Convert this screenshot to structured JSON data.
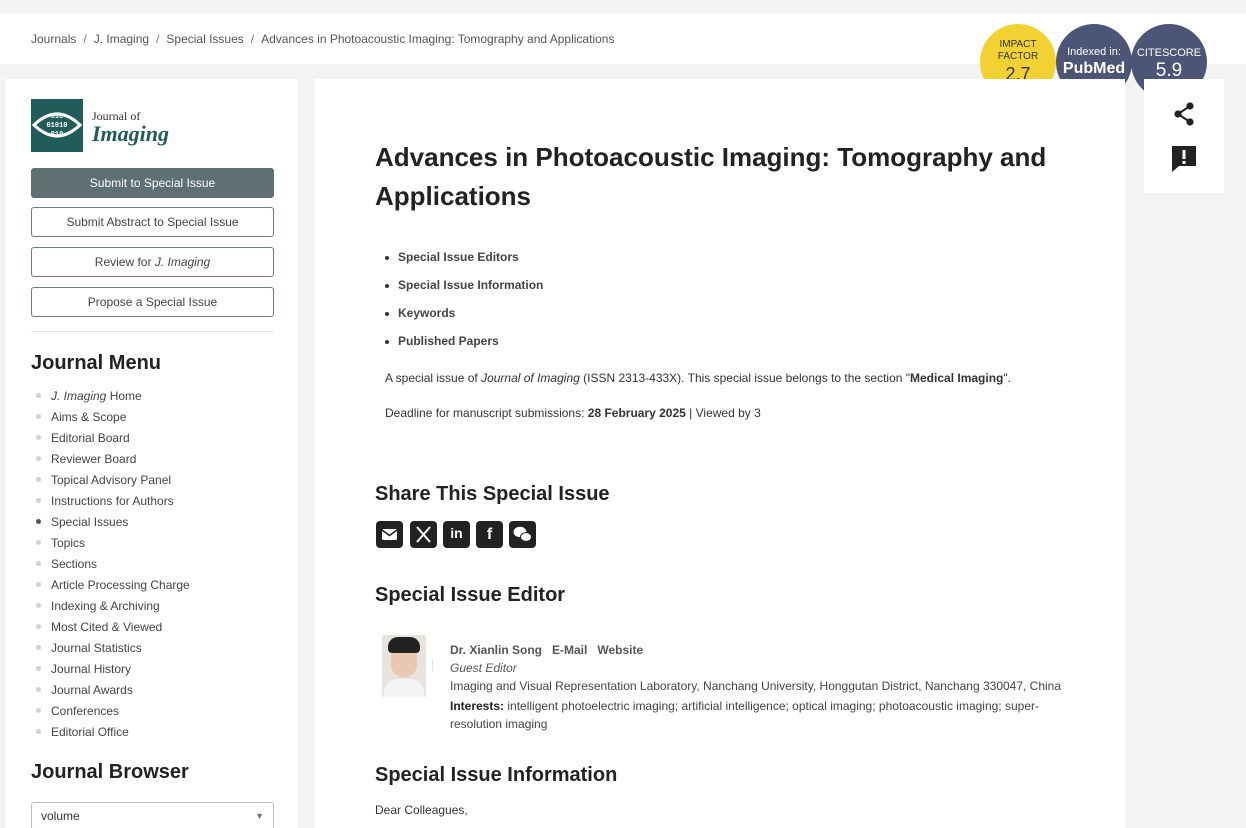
{
  "breadcrumb": {
    "items": [
      "Journals",
      "J. Imaging",
      "Special Issues",
      "Advances in Photoacoustic Imaging: Tomography and Applications"
    ],
    "separator": "/"
  },
  "metrics": {
    "impact_factor_label": "IMPACT FACTOR",
    "impact_factor_value": "2.7",
    "indexed_label": "Indexed in:",
    "indexed_value": "PubMed",
    "citescore_label": "CITESCORE",
    "citescore_value": "5.9"
  },
  "logo": {
    "mark_text": "010\n01010\n010",
    "line1": "Journal of",
    "line2": "Imaging"
  },
  "sidebar": {
    "buttons": {
      "submit": "Submit to Special Issue",
      "submit_abstract": "Submit Abstract to Special Issue",
      "review_prefix": "Review for ",
      "review_journal": "J. Imaging",
      "propose": "Propose a Special Issue"
    },
    "journal_menu_title": "Journal Menu",
    "menu": [
      {
        "prefix": "J. Imaging",
        "label": " Home"
      },
      {
        "prefix": "",
        "label": "Aims & Scope"
      },
      {
        "prefix": "",
        "label": "Editorial Board"
      },
      {
        "prefix": "",
        "label": "Reviewer Board"
      },
      {
        "prefix": "",
        "label": "Topical Advisory Panel"
      },
      {
        "prefix": "",
        "label": "Instructions for Authors"
      },
      {
        "prefix": "",
        "label": "Special Issues"
      },
      {
        "prefix": "",
        "label": "Topics"
      },
      {
        "prefix": "",
        "label": "Sections"
      },
      {
        "prefix": "",
        "label": "Article Processing Charge"
      },
      {
        "prefix": "",
        "label": "Indexing & Archiving"
      },
      {
        "prefix": "",
        "label": "Most Cited & Viewed"
      },
      {
        "prefix": "",
        "label": "Journal Statistics"
      },
      {
        "prefix": "",
        "label": "Journal History"
      },
      {
        "prefix": "",
        "label": "Journal Awards"
      },
      {
        "prefix": "",
        "label": "Conferences"
      },
      {
        "prefix": "",
        "label": "Editorial Office"
      }
    ],
    "journal_browser_title": "Journal Browser",
    "volume_select_value": "volume"
  },
  "main": {
    "title": "Advances in Photoacoustic Imaging: Tomography and Applications",
    "toc": [
      "Special Issue Editors",
      "Special Issue Information",
      "Keywords",
      "Published Papers"
    ],
    "intro": {
      "p1_a": "A special issue of ",
      "p1_journal": "Journal of Imaging",
      "p1_b": " (ISSN 2313-433X). This special issue belongs to the section \"",
      "p1_section": "Medical Imaging",
      "p1_c": "\".",
      "p2_a": "Deadline for manuscript submissions: ",
      "p2_deadline": "28 February 2025",
      "p2_b": " | Viewed by 3"
    },
    "share_title": "Share This Special Issue",
    "share_icons": [
      "email-icon",
      "x-twitter-icon",
      "linkedin-icon",
      "facebook-icon",
      "wechat-icon"
    ],
    "editor_section_title": "Special Issue Editor",
    "editor": {
      "name": "Dr. Xianlin Song",
      "email_link": "E-Mail",
      "website_link": "Website",
      "role": "Guest Editor",
      "affiliation": "Imaging and Visual Representation Laboratory, Nanchang University, Honggutan District, Nanchang 330047, China",
      "interests_label": "Interests:",
      "interests": " intelligent photoelectric imaging; artificial intelligence; optical imaging; photoacoustic imaging; super-resolution imaging"
    },
    "info_section_title": "Special Issue Information",
    "salutation": "Dear Colleagues,"
  },
  "tools": [
    "share-icon",
    "report-icon"
  ],
  "colors": {
    "impact_factor_badge": "#f2d233",
    "dark_badge": "#4d5577",
    "primary_button": "#5f6f74",
    "logo_teal": "#1f5c5a"
  }
}
